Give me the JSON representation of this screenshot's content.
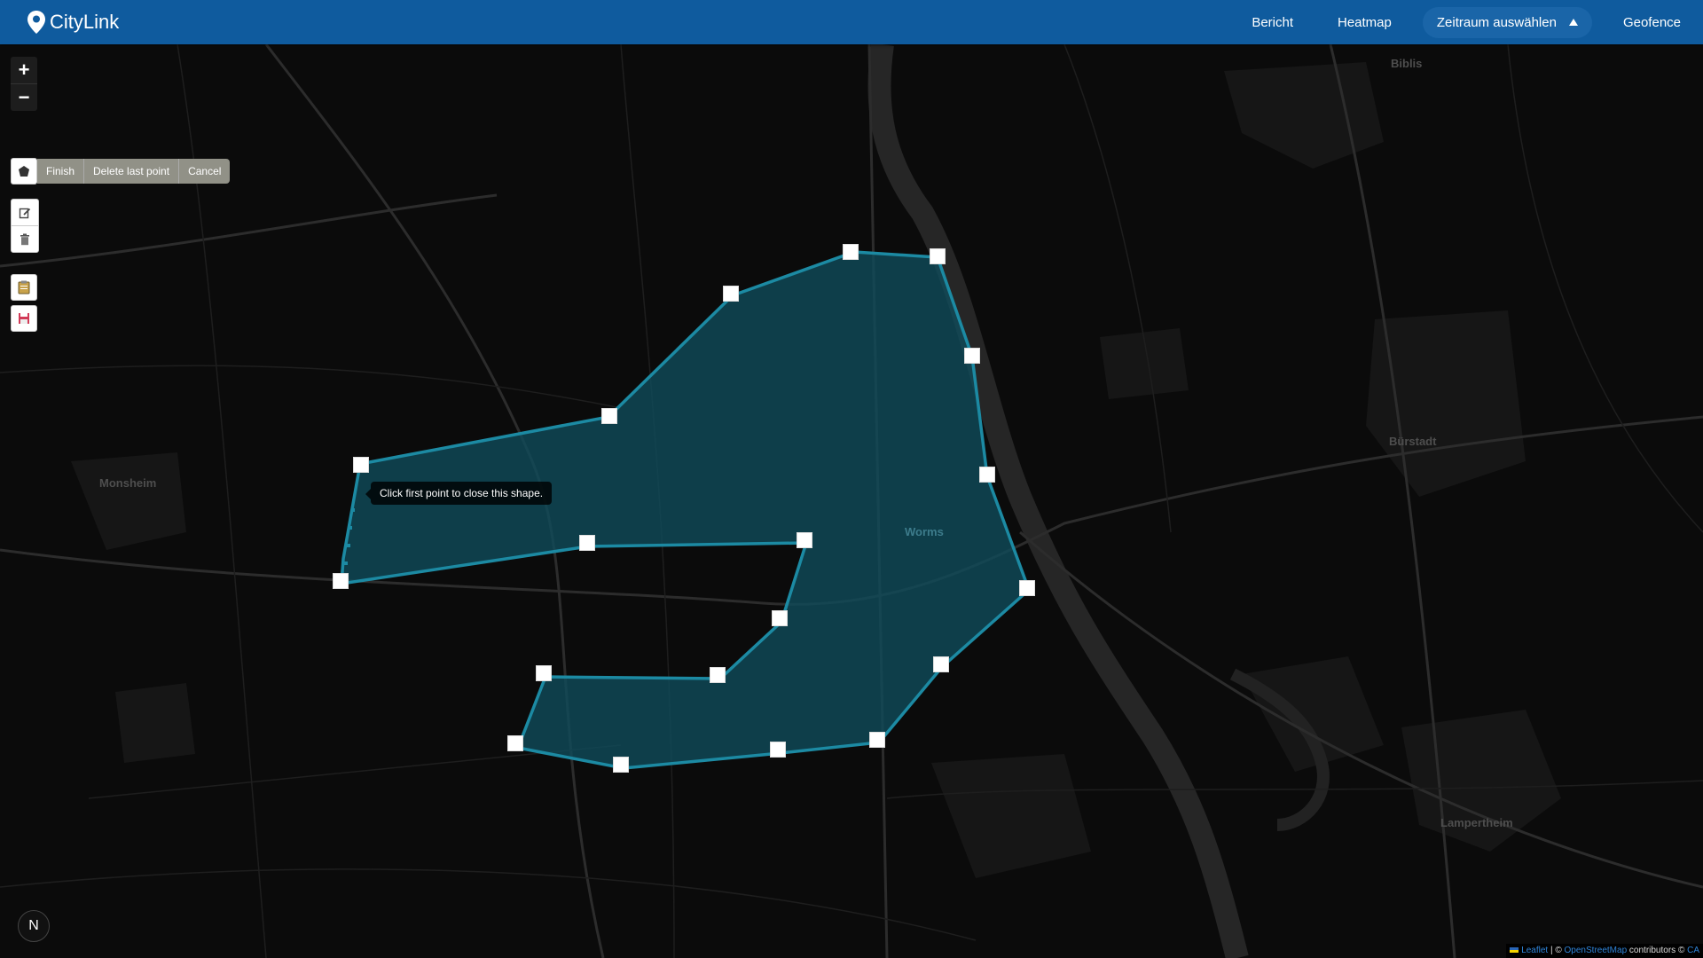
{
  "brand": {
    "name": "CityLink",
    "icon": "map-pin-icon"
  },
  "nav": {
    "items": [
      {
        "label": "Bericht"
      },
      {
        "label": "Heatmap"
      },
      {
        "label": "Zeitraum auswählen",
        "icon": "caret-up-icon"
      },
      {
        "label": "Geofence"
      }
    ]
  },
  "map_controls": {
    "zoom_in": "+",
    "zoom_out": "−"
  },
  "draw_toolbar": {
    "polygon_tool_icon": "polygon-icon",
    "actions": [
      {
        "label": "Finish"
      },
      {
        "label": "Delete last point"
      },
      {
        "label": "Cancel"
      }
    ],
    "edit_icons": [
      "edit-icon",
      "trash-icon"
    ],
    "extra_icons": [
      "clipboard-icon",
      "save-icon"
    ]
  },
  "tooltip": {
    "text": "Click first point to close this shape."
  },
  "map_labels": {
    "biblis": "Biblis",
    "monsheim": "Monsheim",
    "worms": "Worms",
    "buerstadt": "Bürstadt",
    "lampertheim": "Lampertheim"
  },
  "compass": {
    "label": "N"
  },
  "attribution": {
    "leaflet": "Leaflet",
    "sep1": " | © ",
    "osm": "OpenStreetMap",
    "contrib": " contributors © ",
    "carto": "CA"
  },
  "colors": {
    "navbar": "#0f5b9e",
    "polygon_stroke": "#1c8aa3",
    "polygon_fill": "#0f4d5c",
    "map_bg": "#0b0b0b",
    "river": "#262626"
  }
}
